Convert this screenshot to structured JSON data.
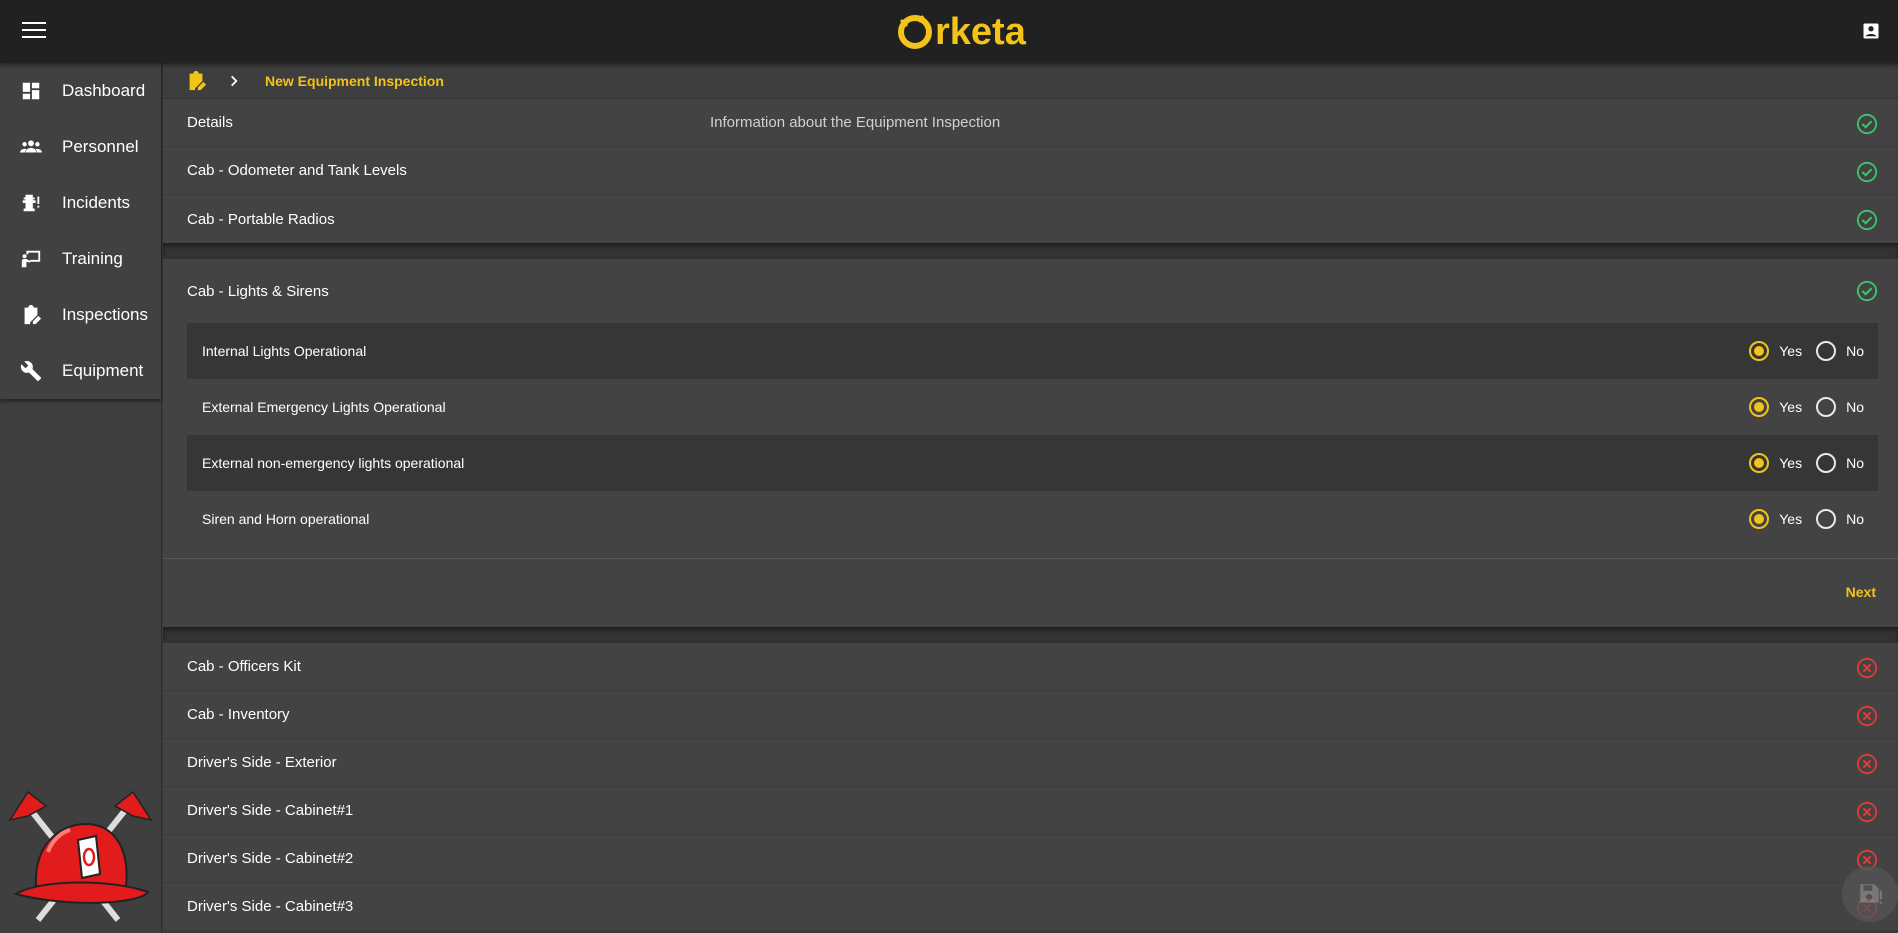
{
  "app": {
    "name": "Orketa",
    "name_tail": "rketa"
  },
  "colors": {
    "accent": "#f2c318",
    "ok": "#3ec46d",
    "error": "#e53935"
  },
  "sidebar": {
    "items": [
      {
        "label": "Dashboard",
        "icon": "dashboard-icon"
      },
      {
        "label": "Personnel",
        "icon": "people-icon"
      },
      {
        "label": "Incidents",
        "icon": "fire-hydrant-icon"
      },
      {
        "label": "Training",
        "icon": "presenter-icon"
      },
      {
        "label": "Inspections",
        "icon": "clipboard-edit-icon"
      },
      {
        "label": "Equipment",
        "icon": "wrench-icon"
      }
    ]
  },
  "breadcrumb": {
    "current": "New Equipment Inspection"
  },
  "sections_top": [
    {
      "title": "Details",
      "desc": "Information about the Equipment Inspection",
      "status": "complete"
    },
    {
      "title": "Cab - Odometer and Tank Levels",
      "status": "complete"
    },
    {
      "title": "Cab - Portable Radios",
      "status": "complete"
    }
  ],
  "active_section": {
    "title": "Cab - Lights & Sirens",
    "status": "complete",
    "questions": [
      {
        "label": "Internal Lights Operational",
        "value": "Yes"
      },
      {
        "label": "External Emergency Lights Operational",
        "value": "Yes"
      },
      {
        "label": "External non-emergency lights operational",
        "value": "Yes"
      },
      {
        "label": "Siren and Horn operational",
        "value": "Yes"
      }
    ],
    "yes_label": "Yes",
    "no_label": "No",
    "next_label": "Next"
  },
  "sections_bottom": [
    {
      "title": "Cab - Officers Kit",
      "status": "incomplete"
    },
    {
      "title": "Cab - Inventory",
      "status": "incomplete"
    },
    {
      "title": "Driver's Side - Exterior",
      "status": "incomplete"
    },
    {
      "title": "Driver's Side - Cabinet#1",
      "status": "incomplete"
    },
    {
      "title": "Driver's Side - Cabinet#2",
      "status": "incomplete"
    },
    {
      "title": "Driver's Side - Cabinet#3",
      "status": "incomplete"
    }
  ]
}
